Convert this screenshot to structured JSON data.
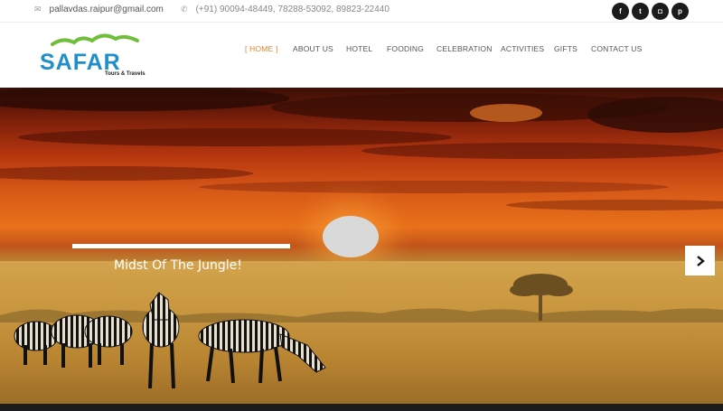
{
  "topbar": {
    "email_icon": "envelope-icon",
    "email": "pallavdas.raipur@gmail.com",
    "phone_icon": "phone-icon",
    "phone": "(+91) 90094-48449, 78288-53092, 89823-22440",
    "social": [
      {
        "icon": "facebook-icon",
        "glyph": "f"
      },
      {
        "icon": "twitter-icon",
        "glyph": "t"
      },
      {
        "icon": "instagram-icon",
        "glyph": "◘"
      },
      {
        "icon": "pinterest-icon",
        "glyph": "p"
      }
    ]
  },
  "logo": {
    "brand": "SAFAR",
    "tagline": "Tours & Travels"
  },
  "nav": {
    "items": [
      {
        "label": "HOME",
        "active": true
      },
      {
        "label": "ABOUT US"
      },
      {
        "label": "HOTEL"
      },
      {
        "label": "FOODING"
      },
      {
        "label": "CELEBRATION"
      },
      {
        "label": "ACTIVITIES"
      },
      {
        "label": "GIFTS"
      },
      {
        "label": "CONTACT US"
      }
    ],
    "active_color": "#e8822a"
  },
  "hero": {
    "caption": "Midst Of The Jungle!",
    "next_icon": "chevron-right-icon"
  }
}
